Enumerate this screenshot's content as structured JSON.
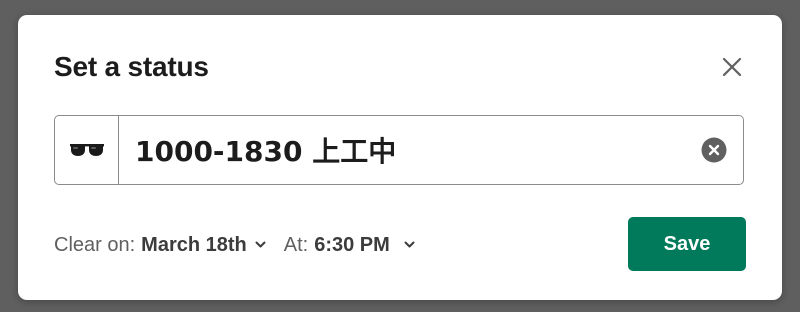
{
  "dialog": {
    "title": "Set a status",
    "close_icon": "close-icon"
  },
  "status": {
    "emoji_icon": "sunglasses-icon",
    "value": "1000-1830 上工中",
    "clear_icon": "clear-circle-x-icon"
  },
  "footer": {
    "clear_on_label": "Clear on:",
    "clear_on_value": "March 18th",
    "at_label": "At:",
    "at_value": "6:30 PM",
    "save_label": "Save"
  },
  "colors": {
    "save_button_bg": "#007a5a",
    "border": "#8b8b8b",
    "backdrop": "#5f5f5f"
  }
}
